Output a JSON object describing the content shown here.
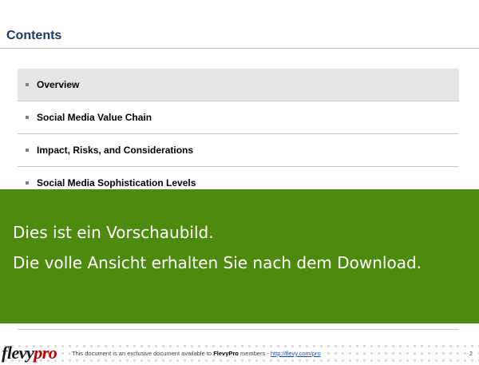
{
  "page": {
    "title": "Contents"
  },
  "toc": {
    "items": [
      {
        "label": "Overview",
        "active": true
      },
      {
        "label": "Social Media Value Chain",
        "active": false
      },
      {
        "label": "Impact, Risks, and Considerations",
        "active": false
      },
      {
        "label": "Social Media Sophistication Levels",
        "active": false
      }
    ]
  },
  "banner": {
    "line1": "Dies ist ein Vorschaubild.",
    "line2": "Die volle Ansicht erhalten Sie nach dem Download.",
    "color": "#4e8a0e"
  },
  "footer": {
    "logo_part1": "flevy",
    "logo_part2": "pro",
    "note_prefix": "This document is an exclusive document available to ",
    "note_brand": "FlevyPro",
    "note_middle": " members - ",
    "note_link": "http://flevy.com/pro",
    "page_number": "2"
  }
}
